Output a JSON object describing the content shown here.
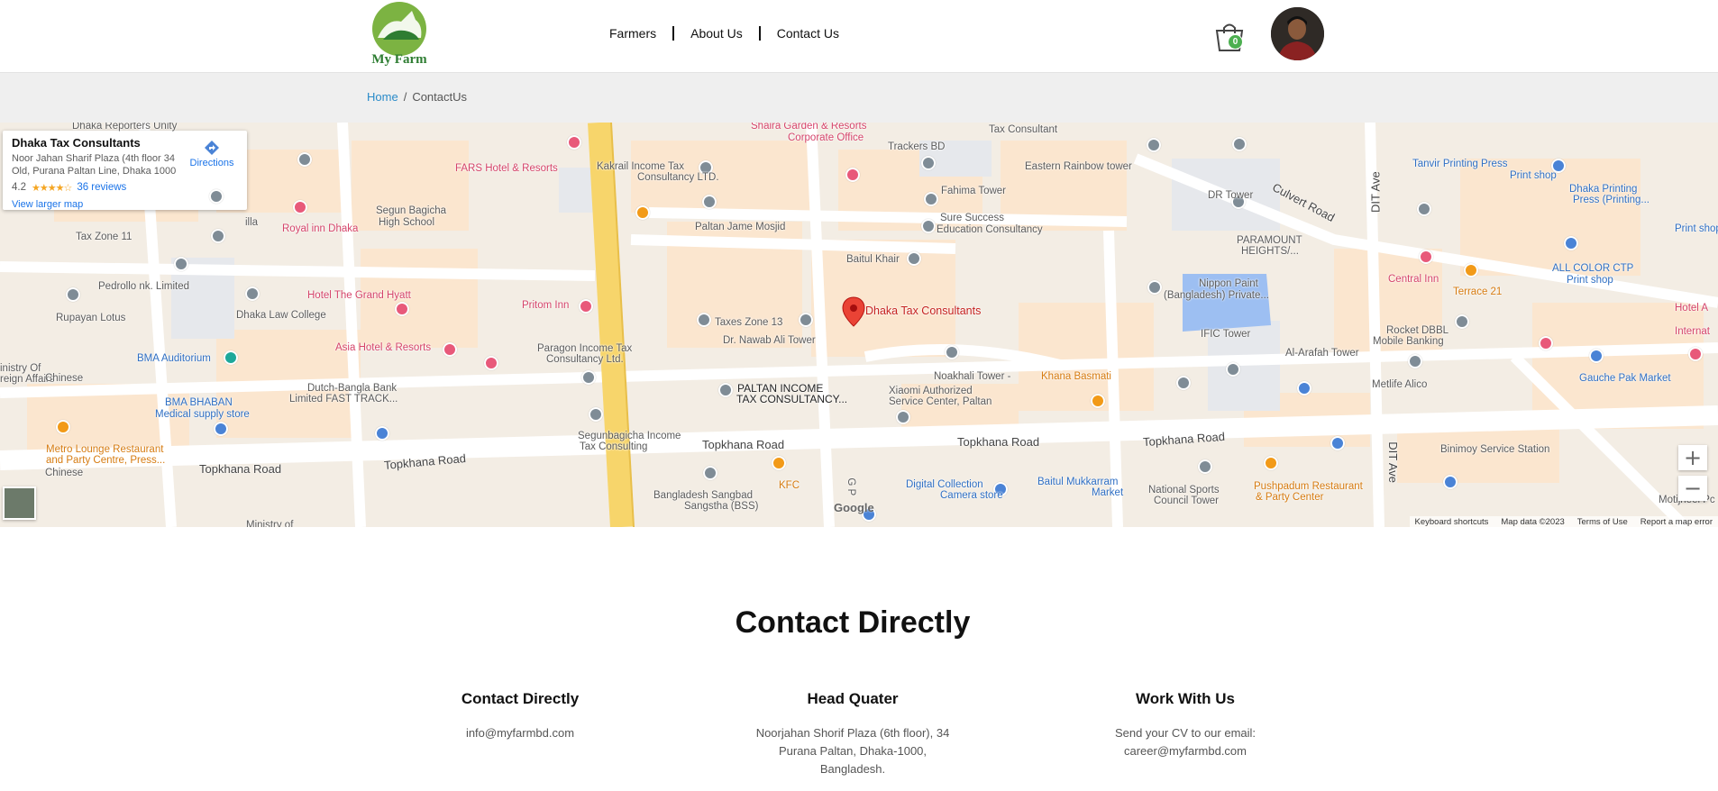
{
  "brand": {
    "logo_text": "My Farm",
    "logo_icon": "farm-logo-icon"
  },
  "nav": {
    "items": [
      {
        "label": "Farmers"
      },
      {
        "label": "About Us"
      },
      {
        "label": "Contact Us"
      }
    ]
  },
  "cart": {
    "icon": "shopping-bag-icon",
    "count": "0"
  },
  "user": {
    "avatar_icon": "user-avatar"
  },
  "breadcrumb": {
    "home": "Home",
    "separator": "/",
    "current": "ContactUs"
  },
  "map": {
    "place": {
      "name": "Dhaka Tax Consultants",
      "address": "Noor Jahan Sharif Plaza (4th floor 34 Old, Purana Paltan Line, Dhaka 1000",
      "rating": "4.2",
      "stars": "★★★★☆",
      "reviews": "36 reviews",
      "directions": "Directions",
      "larger_map": "View larger map"
    },
    "marker_label": "Dhaka Tax Consultants",
    "labels": {
      "l1": "Dhaka Reporters Unity",
      "l2": "Shaira Garden & Resorts",
      "l3": "Corporate Office",
      "l4": "Tax Consultant",
      "l5": "Trackers BD",
      "l6": "FARS Hotel & Resorts",
      "l7": "Kakrail Income Tax",
      "l8": "Consultancy LTD.",
      "l9": "Eastern Rainbow tower",
      "l10": "Tanvir Printing Press",
      "l11": "Print shop",
      "l12": "Culvert Road",
      "l13": "DIT Ave",
      "l14": "Fahima Tower",
      "l15": "DR Tower",
      "l16": "Dhaka Printing",
      "l17": "Press (Printing...",
      "l18": "Segun Bagicha",
      "l19": "High School",
      "l20": "Royal inn Dhaka",
      "l21": "Paltan Jame Mosjid",
      "l22": "Sure Success",
      "l23": "Education Consultancy",
      "l24": "PARAMOUNT",
      "l25": "HEIGHTS/...",
      "l26": "Tax Zone 11",
      "l27": "Baitul Khair",
      "l28": "ALL COLOR CTP",
      "l29": "Print shop",
      "l30": "Pedrollo nk. Limited",
      "l31": "Hotel The Grand Hyatt",
      "l32": "Central Inn",
      "l33": "Terrace 21",
      "l34": "Nippon Paint",
      "l35": "(Bangladesh) Private...",
      "l36": "Rupayan Lotus",
      "l37": "Dhaka Law College",
      "l38": "Pritom Inn",
      "l39": "Taxes Zone 13",
      "l40": "Rocket DBBL",
      "l41": "Mobile Banking",
      "l42": "Dr. Nawab Ali Tower",
      "l43": "IFIC Tower",
      "l44": "Asia Hotel & Resorts",
      "l45": "Paragon Income Tax",
      "l46": "Consultancy Ltd.",
      "l47": "Al-Arafah Tower",
      "l48": "BMA Auditorium",
      "l49": "Noakhali Tower -",
      "l50": "Khana Basmati",
      "l51": "PALTAN INCOME",
      "l52": "TAX CONSULTANCY...",
      "l53": "Dutch-Bangla Bank",
      "l54": "Limited FAST TRACK...",
      "l55": "Xiaomi Authorized",
      "l56": "Service Center, Paltan",
      "l57": "Metlife Alico",
      "l58": "Gauche Pak Market",
      "l59": "BMA BHABAN",
      "l60": "Medical supply store",
      "l61": "inistry Of",
      "l62": "reign Affairs",
      "l63": "Chinese",
      "l64": "Segunbagicha Income",
      "l65": "Tax Consulting",
      "l66": "Topkhana Road",
      "l67": "Topkhana Road",
      "l68": "Topkhana Road",
      "l69": "Topkhana Road",
      "l70": "Metro Lounge Restaurant",
      "l71": "and Party Centre, Press...",
      "l72": "Binimoy Service Station",
      "l73": "Topkhana Road",
      "l74": "KFC",
      "l75": "Digital Collection",
      "l76": "Camera store",
      "l77": "Baitul Mukkarram",
      "l78": "Market",
      "l79": "National Sports",
      "l80": "Council Tower",
      "l81": "Pushpadum Restaurant",
      "l82": "& Party Center",
      "l83": "Bangladesh Sangbad",
      "l84": "Sangstha (BSS)",
      "l85": "DIT Ave",
      "l86": "Ministry of",
      "l87": "Internat",
      "l88": "Hotel A",
      "l89": "Print shop",
      "l90": "Motijheel Pc",
      "l91": "G P",
      "l92": "illa",
      "l93": "Chinese"
    },
    "google": "Google",
    "attribution": {
      "shortcuts": "Keyboard shortcuts",
      "data": "Map data ©2023",
      "terms": "Terms of Use",
      "report": "Report a map error"
    },
    "zoom_in": "+",
    "zoom_out": "−"
  },
  "contact": {
    "title": "Contact Directly",
    "columns": [
      {
        "heading": "Contact Directly",
        "lines": [
          "info@myfarmbd.com"
        ]
      },
      {
        "heading": "Head Quater",
        "lines": [
          "Noorjahan Shorif Plaza (6th floor), 34",
          "Purana Paltan, Dhaka-1000,",
          "Bangladesh."
        ]
      },
      {
        "heading": "Work With Us",
        "lines": [
          "Send your CV to our email:",
          "career@myfarmbd.com"
        ]
      }
    ]
  },
  "colors": {
    "accent_link": "#2a8bc9",
    "badge_green": "#4caf50",
    "map_yellow_road": "#f7d56b",
    "marker_red": "#ea4335"
  }
}
